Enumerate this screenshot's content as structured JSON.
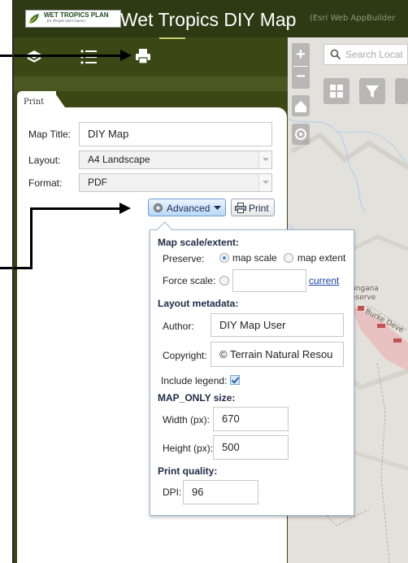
{
  "header": {
    "logo": {
      "line1": "WET TROPICS PLAN",
      "line2": "for People and Country"
    },
    "title": "Wet Tropics DIY Map",
    "subtitle": "(Esri Web AppBuilder"
  },
  "toolbar": {
    "icons": [
      "layers-icon",
      "legend-list-icon",
      "print-icon"
    ],
    "active": "print-icon"
  },
  "print_panel": {
    "tab_label": "Print",
    "map_title_label": "Map Title:",
    "map_title_value": "DIY Map",
    "layout_label": "Layout:",
    "layout_value": "A4 Landscape",
    "format_label": "Format:",
    "format_value": "PDF",
    "advanced_button": "Advanced",
    "print_button": "Print"
  },
  "advanced": {
    "scale_section": "Map scale/extent:",
    "preserve_label": "Preserve:",
    "preserve_options": [
      "map scale",
      "map extent"
    ],
    "preserve_selected": "map scale",
    "force_scale_label": "Force scale:",
    "force_scale_value": "",
    "current_link": "current",
    "metadata_section": "Layout metadata:",
    "author_label": "Author:",
    "author_value": "DIY Map User",
    "copyright_label": "Copyright:",
    "copyright_value": "© Terrain Natural Resou",
    "include_legend_label": "Include legend:",
    "include_legend_checked": true,
    "size_section": "MAP_ONLY size:",
    "width_label": "Width (px):",
    "width_value": "670",
    "height_label": "Height (px):",
    "height_value": "500",
    "quality_section": "Print quality:",
    "dpi_label": "DPI:",
    "dpi_value": "96"
  },
  "map": {
    "search_placeholder": "Search Locat",
    "zoom_in": "+",
    "zoom_out": "−",
    "place_labels": [
      "ungana",
      "eserve",
      "Burke Deve"
    ]
  },
  "colors": {
    "header_bg": "#2e3a14",
    "toolbar_bg": "#3b4815",
    "accent_underline": "#c7d06a",
    "link": "#1a3fa8"
  }
}
